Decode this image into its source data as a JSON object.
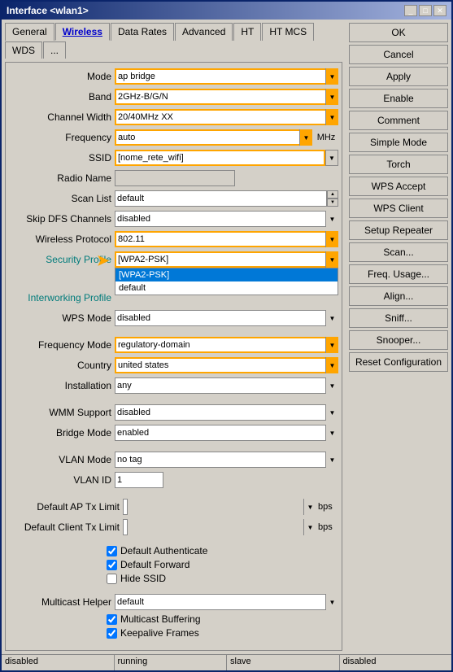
{
  "window": {
    "title": "Interface <wlan1>",
    "title_btns": [
      "□",
      "✕"
    ]
  },
  "tabs": [
    {
      "label": "General",
      "active": false
    },
    {
      "label": "Wireless",
      "active": true
    },
    {
      "label": "Data Rates",
      "active": false
    },
    {
      "label": "Advanced",
      "active": false
    },
    {
      "label": "HT",
      "active": false
    },
    {
      "label": "HT MCS",
      "active": false
    },
    {
      "label": "WDS",
      "active": false
    },
    {
      "label": "...",
      "active": false
    }
  ],
  "form": {
    "mode_label": "Mode",
    "mode_value": "ap bridge",
    "band_label": "Band",
    "band_value": "2GHz-B/G/N",
    "channel_width_label": "Channel Width",
    "channel_width_value": "20/40MHz XX",
    "frequency_label": "Frequency",
    "frequency_value": "auto",
    "frequency_unit": "MHz",
    "ssid_label": "SSID",
    "ssid_value": "[nome_rete_wifi]",
    "radio_name_label": "Radio Name",
    "radio_name_value": "",
    "scan_list_label": "Scan List",
    "scan_list_value": "default",
    "skip_dfs_label": "Skip DFS Channels",
    "skip_dfs_value": "disabled",
    "wireless_protocol_label": "Wireless Protocol",
    "wireless_protocol_value": "802.11",
    "security_profile_label": "Security Profile",
    "security_profile_value": "[WPA2-PSK]",
    "security_profile_dropdown": [
      "[WPA2-PSK]",
      "default"
    ],
    "interworking_label": "Interworking Profile",
    "wps_mode_label": "WPS Mode",
    "wps_mode_value": "disabled",
    "frequency_mode_label": "Frequency Mode",
    "frequency_mode_value": "regulatory-domain",
    "country_label": "Country",
    "country_value": "united states",
    "installation_label": "Installation",
    "installation_value": "any",
    "wmm_label": "WMM Support",
    "wmm_value": "disabled",
    "bridge_mode_label": "Bridge Mode",
    "bridge_mode_value": "enabled",
    "vlan_mode_label": "VLAN Mode",
    "vlan_mode_value": "no tag",
    "vlan_id_label": "VLAN ID",
    "vlan_id_value": "1",
    "default_ap_label": "Default AP Tx Limit",
    "default_client_label": "Default Client Tx Limit",
    "bps": "bps",
    "cb_default_auth": "Default Authenticate",
    "cb_default_fwd": "Default Forward",
    "cb_hide_ssid": "Hide SSID",
    "multicast_helper_label": "Multicast Helper",
    "multicast_helper_value": "default",
    "cb_multicast_buf": "Multicast Buffering",
    "cb_keepalive": "Keepalive Frames"
  },
  "buttons": {
    "ok": "OK",
    "cancel": "Cancel",
    "apply": "Apply",
    "enable": "Enable",
    "comment": "Comment",
    "simple_mode": "Simple Mode",
    "torch": "Torch",
    "wps_accept": "WPS Accept",
    "wps_client": "WPS Client",
    "setup_repeater": "Setup Repeater",
    "scan": "Scan...",
    "freq_usage": "Freq. Usage...",
    "align": "Align...",
    "sniff": "Sniff...",
    "snooper": "Snooper...",
    "reset_config": "Reset Configuration"
  },
  "status_bar": {
    "s1": "disabled",
    "s2": "running",
    "s3": "slave",
    "s4": "disabled"
  },
  "colors": {
    "orange": "#ffa500",
    "cyan": "#007b7b",
    "blue_tab": "#0000cc",
    "highlight_blue": "#0078d7",
    "title_bar_start": "#0a246a",
    "title_bar_end": "#a6b5e0"
  }
}
